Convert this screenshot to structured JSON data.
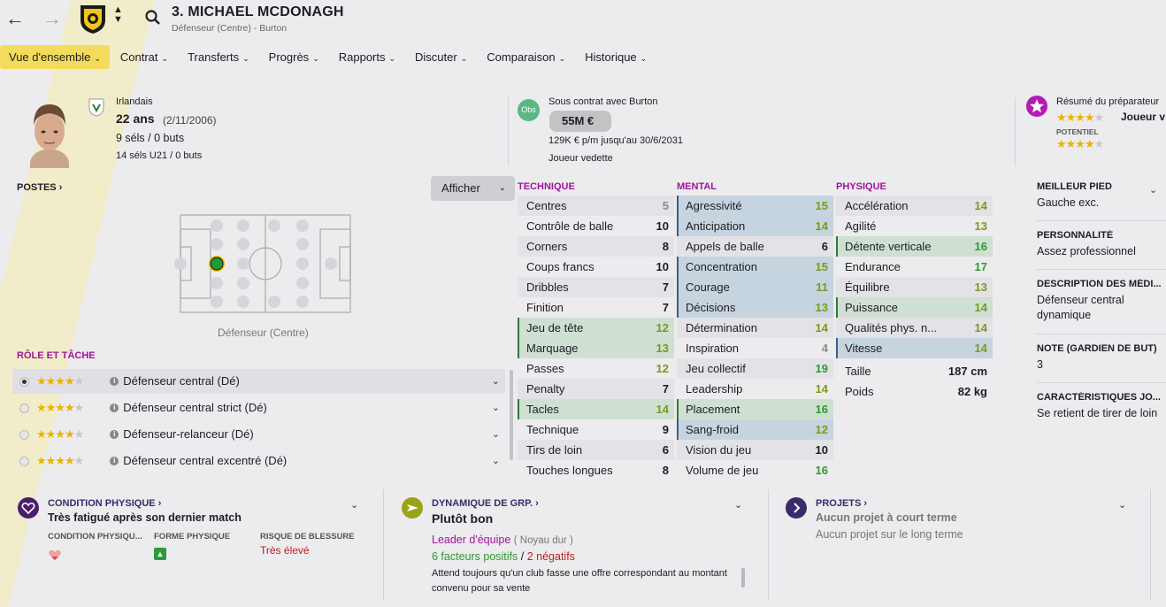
{
  "header": {
    "player_name": "3. MICHAEL MCDONAGH",
    "player_sub": "Défenseur (Centre) - Burton"
  },
  "tabs": [
    {
      "label": "Vue d'ensemble"
    },
    {
      "label": "Contrat"
    },
    {
      "label": "Transferts"
    },
    {
      "label": "Progrès"
    },
    {
      "label": "Rapports"
    },
    {
      "label": "Discuter"
    },
    {
      "label": "Comparaison"
    },
    {
      "label": "Historique"
    }
  ],
  "profile": {
    "nationality": "Irlandais",
    "age": "22 ans",
    "dob": "(2/11/2006)",
    "caps": "9 séls / 0 buts",
    "u21_caps": "14 séls U21 / 0 buts"
  },
  "contract": {
    "badge": "Obs",
    "club": "Sous contrat avec Burton",
    "value": "55M €",
    "wage": "129K € p/m jusqu'au 30/6/2031",
    "status": "Joueur vedette"
  },
  "coach": {
    "title": "Résumé du préparateur",
    "role": "Joueur v",
    "potential_label": "POTENTIEL",
    "current_stars": 4,
    "potential_stars": 4
  },
  "positions": {
    "heading": "POSTES",
    "show_button": "Afficher",
    "caption": "Défenseur (Centre)"
  },
  "roles": {
    "heading": "RÔLE ET TÂCHE",
    "items": [
      {
        "label": "Défenseur central (Dé)",
        "stars": 4,
        "selected": true
      },
      {
        "label": "Défenseur central strict (Dé)",
        "stars": 4,
        "selected": false
      },
      {
        "label": "Défenseur-relanceur (Dé)",
        "stars": 4,
        "selected": false
      },
      {
        "label": "Défenseur central excentré (Dé)",
        "stars": 4,
        "selected": false
      }
    ]
  },
  "attributes": {
    "technique": {
      "heading": "TECHNIQUE",
      "rows": [
        {
          "name": "Centres",
          "value": "5",
          "hl": ""
        },
        {
          "name": "Contrôle de balle",
          "value": "10",
          "hl": ""
        },
        {
          "name": "Corners",
          "value": "8",
          "hl": ""
        },
        {
          "name": "Coups francs",
          "value": "10",
          "hl": ""
        },
        {
          "name": "Dribbles",
          "value": "7",
          "hl": ""
        },
        {
          "name": "Finition",
          "value": "7",
          "hl": ""
        },
        {
          "name": "Jeu de tête",
          "value": "12",
          "hl": "pkey"
        },
        {
          "name": "Marquage",
          "value": "13",
          "hl": "pkey"
        },
        {
          "name": "Passes",
          "value": "12",
          "hl": ""
        },
        {
          "name": "Penalty",
          "value": "7",
          "hl": ""
        },
        {
          "name": "Tacles",
          "value": "14",
          "hl": "pkey"
        },
        {
          "name": "Technique",
          "value": "9",
          "hl": ""
        },
        {
          "name": "Tirs de loin",
          "value": "6",
          "hl": ""
        },
        {
          "name": "Touches longues",
          "value": "8",
          "hl": ""
        }
      ]
    },
    "mental": {
      "heading": "MENTAL",
      "rows": [
        {
          "name": "Agressivité",
          "value": "15",
          "hl": "key"
        },
        {
          "name": "Anticipation",
          "value": "14",
          "hl": "key"
        },
        {
          "name": "Appels de balle",
          "value": "6",
          "hl": ""
        },
        {
          "name": "Concentration",
          "value": "15",
          "hl": "key"
        },
        {
          "name": "Courage",
          "value": "11",
          "hl": "key"
        },
        {
          "name": "Décisions",
          "value": "13",
          "hl": "key"
        },
        {
          "name": "Détermination",
          "value": "14",
          "hl": ""
        },
        {
          "name": "Inspiration",
          "value": "4",
          "hl": ""
        },
        {
          "name": "Jeu collectif",
          "value": "19",
          "hl": ""
        },
        {
          "name": "Leadership",
          "value": "14",
          "hl": ""
        },
        {
          "name": "Placement",
          "value": "16",
          "hl": "pkey"
        },
        {
          "name": "Sang-froid",
          "value": "12",
          "hl": "key"
        },
        {
          "name": "Vision du jeu",
          "value": "10",
          "hl": ""
        },
        {
          "name": "Volume de jeu",
          "value": "16",
          "hl": ""
        }
      ]
    },
    "physique": {
      "heading": "PHYSIQUE",
      "rows": [
        {
          "name": "Accélération",
          "value": "14",
          "hl": ""
        },
        {
          "name": "Agilité",
          "value": "13",
          "hl": ""
        },
        {
          "name": "Détente verticale",
          "value": "16",
          "hl": "pkey"
        },
        {
          "name": "Endurance",
          "value": "17",
          "hl": ""
        },
        {
          "name": "Équilibre",
          "value": "13",
          "hl": ""
        },
        {
          "name": "Puissance",
          "value": "14",
          "hl": "pkey"
        },
        {
          "name": "Qualités phys. n...",
          "value": "14",
          "hl": ""
        },
        {
          "name": "Vitesse",
          "value": "14",
          "hl": "key"
        }
      ],
      "height_label": "Taille",
      "height": "187 cm",
      "weight_label": "Poids",
      "weight": "82 kg"
    }
  },
  "side_info": [
    {
      "heading": "MEILLEUR PIED",
      "text": "Gauche exc."
    },
    {
      "heading": "PERSONNALITÉ",
      "text": "Assez professionnel"
    },
    {
      "heading": "DESCRIPTION DES MÉDI...",
      "text": "Défenseur central dynamique"
    },
    {
      "heading": "NOTE (GARDIEN DE BUT)",
      "text": "3"
    },
    {
      "heading": "CARACTÉRISTIQUES JO...",
      "text": "Se retient de tirer de loin"
    }
  ],
  "condition": {
    "heading": "CONDITION PHYSIQUE",
    "status": "Très fatigué après son dernier match",
    "col1": "CONDITION PHYSIQU...",
    "col2": "FORME PHYSIQUE",
    "col3": "RISQUE DE BLESSURE",
    "risk": "Très élevé"
  },
  "dynamics": {
    "heading": "DYNAMIQUE DE GRP.",
    "status": "Plutôt bon",
    "role": "Leader d'équipe",
    "role_group": "( Noyau dur )",
    "positives": "6 facteurs positifs",
    "slash": "/",
    "negatives": "2 négatifs",
    "note": "Attend toujours qu'un club fasse une offre correspondant au montant convenu pour sa vente"
  },
  "projects": {
    "heading": "PROJETS",
    "short": "Aucun projet à court terme",
    "long": "Aucun projet sur le long terme"
  },
  "colors": {
    "accent": "#f3dc5b",
    "purple": "#a2139c",
    "green": "#2e9a2e"
  }
}
